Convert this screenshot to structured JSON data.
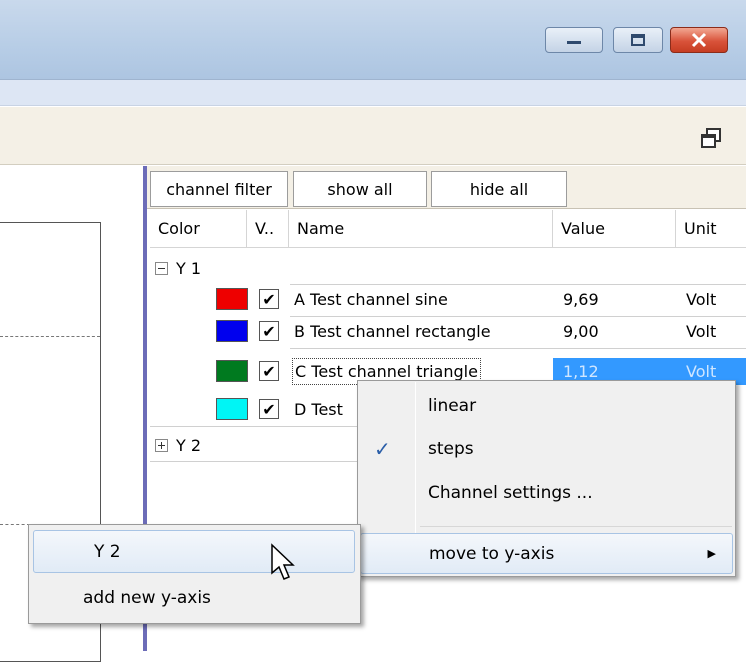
{
  "filter_bar": {
    "channel_filter": "channel filter",
    "show_all": "show all",
    "hide_all": "hide all"
  },
  "columns": {
    "color": "Color",
    "visible": "V..",
    "name": "Name",
    "value": "Value",
    "unit": "Unit"
  },
  "groups": {
    "y1": {
      "label": "Y 1",
      "expanded": true,
      "channels": [
        {
          "color": "#ee0000",
          "checked": "✔",
          "name": "A Test channel sine",
          "value": "9,69",
          "unit": "Volt"
        },
        {
          "color": "#0000ee",
          "checked": "✔",
          "name": "B Test channel rectangle",
          "value": "9,00",
          "unit": "Volt"
        },
        {
          "color": "#007a1f",
          "checked": "✔",
          "name": "C Test channel triangle",
          "value": "1,12",
          "unit": "Volt"
        },
        {
          "color": "#00f5f5",
          "checked": "✔",
          "name": "D Test",
          "value": "",
          "unit": ""
        }
      ]
    },
    "y2": {
      "label": "Y 2",
      "expanded": false
    }
  },
  "context_menu": {
    "linear": "linear",
    "steps": "steps",
    "steps_check": "✓",
    "channel_settings": "Channel settings ...",
    "move_to_y_axis": "move to y-axis",
    "submenu_arrow": "▶"
  },
  "submenu": {
    "y2": "Y 2",
    "add_new": "add new y-axis"
  },
  "colors": {
    "selection": "#3399ff",
    "splitter": "#6c6cb8"
  }
}
